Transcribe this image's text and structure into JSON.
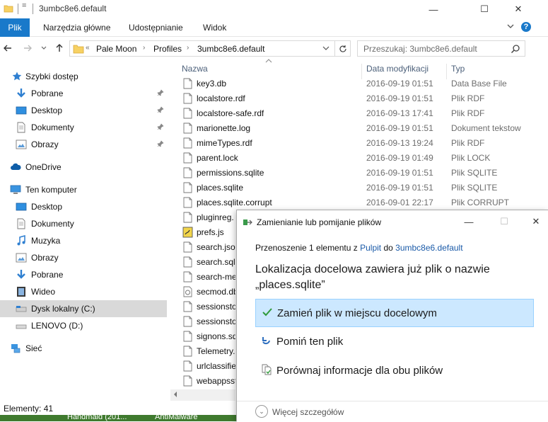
{
  "window": {
    "title": "3umbc8e6.default",
    "quick_access_dropdown": "=",
    "minimize": "—",
    "maximize": "☐",
    "close": "✕"
  },
  "ribbon": {
    "tabs": [
      "Plik",
      "Narzędzia główne",
      "Udostępnianie",
      "Widok"
    ],
    "help": "?"
  },
  "address": {
    "prefix": "«",
    "crumbs": [
      "Pale Moon",
      "Profiles",
      "3umbc8e6.default"
    ],
    "search_placeholder": "Przeszukaj: 3umbc8e6.default"
  },
  "navpane": {
    "items": [
      {
        "label": "Szybki dostęp",
        "icon": "star-icon",
        "pinned": false
      },
      {
        "label": "Pobrane",
        "icon": "download-arrow-icon",
        "pinned": true
      },
      {
        "label": "Desktop",
        "icon": "desktop-icon",
        "pinned": true
      },
      {
        "label": "Dokumenty",
        "icon": "documents-icon",
        "pinned": true
      },
      {
        "label": "Obrazy",
        "icon": "pictures-icon",
        "pinned": true
      },
      {
        "label": "OneDrive",
        "icon": "cloud-icon",
        "pinned": false
      },
      {
        "label": "Ten komputer",
        "icon": "computer-icon",
        "pinned": false
      },
      {
        "label": "Desktop",
        "icon": "desktop-icon",
        "pinned": false
      },
      {
        "label": "Dokumenty",
        "icon": "documents-icon",
        "pinned": false
      },
      {
        "label": "Muzyka",
        "icon": "music-icon",
        "pinned": false
      },
      {
        "label": "Obrazy",
        "icon": "pictures-icon",
        "pinned": false
      },
      {
        "label": "Pobrane",
        "icon": "download-arrow-icon",
        "pinned": false
      },
      {
        "label": "Wideo",
        "icon": "video-icon",
        "pinned": false
      },
      {
        "label": "Dysk lokalny (C:)",
        "icon": "drive-icon",
        "pinned": false,
        "selected": true
      },
      {
        "label": "LENOVO (D:)",
        "icon": "drive-icon",
        "pinned": false
      },
      {
        "label": "Sieć",
        "icon": "network-icon",
        "pinned": false
      }
    ]
  },
  "filelist": {
    "columns": {
      "name": "Nazwa",
      "date": "Data modyfikacji",
      "type": "Typ"
    },
    "rows": [
      {
        "name": "key3.db",
        "date": "2016-09-19 01:51",
        "type": "Data Base File"
      },
      {
        "name": "localstore.rdf",
        "date": "2016-09-19 01:51",
        "type": "Plik RDF"
      },
      {
        "name": "localstore-safe.rdf",
        "date": "2016-09-13 17:41",
        "type": "Plik RDF"
      },
      {
        "name": "marionette.log",
        "date": "2016-09-19 01:51",
        "type": "Dokument tekstow"
      },
      {
        "name": "mimeTypes.rdf",
        "date": "2016-09-13 19:24",
        "type": "Plik RDF"
      },
      {
        "name": "parent.lock",
        "date": "2016-09-19 01:49",
        "type": "Plik LOCK"
      },
      {
        "name": "permissions.sqlite",
        "date": "2016-09-19 01:51",
        "type": "Plik SQLITE"
      },
      {
        "name": "places.sqlite",
        "date": "2016-09-19 01:51",
        "type": "Plik SQLITE"
      },
      {
        "name": "places.sqlite.corrupt",
        "date": "2016-09-01 22:17",
        "type": "Plik CORRUPT"
      },
      {
        "name": "pluginreg.",
        "date": "",
        "type": ""
      },
      {
        "name": "prefs.js",
        "date": "",
        "type": ""
      },
      {
        "name": "search.json",
        "date": "",
        "type": ""
      },
      {
        "name": "search.sqli",
        "date": "",
        "type": ""
      },
      {
        "name": "search-me",
        "date": "",
        "type": ""
      },
      {
        "name": "secmod.db",
        "date": "",
        "type": ""
      },
      {
        "name": "sessionsto",
        "date": "",
        "type": ""
      },
      {
        "name": "sessionsto",
        "date": "",
        "type": ""
      },
      {
        "name": "signons.sq",
        "date": "",
        "type": ""
      },
      {
        "name": "Telemetry.",
        "date": "",
        "type": ""
      },
      {
        "name": "urlclassifie",
        "date": "",
        "type": ""
      },
      {
        "name": "webappsst",
        "date": "",
        "type": ""
      }
    ]
  },
  "status": {
    "count": "Elementy: 41"
  },
  "taskbar": {
    "items": [
      "Handmaid (201...",
      "AntiMalware"
    ]
  },
  "dialog": {
    "title": "Zamienianie lub pomijanie plików",
    "minimize": "—",
    "maximize": "☐",
    "close": "✕",
    "info_prefix": "Przenoszenie 1 elementu z ",
    "info_source": "Pulpit",
    "info_middle": " do ",
    "info_dest": "3umbc8e6.default",
    "heading": "Lokalizacja docelowa zawiera już plik o nazwie „places.sqlite”",
    "options": [
      {
        "label": "Zamień plik w miejscu docelowym",
        "icon": "checkmark-icon"
      },
      {
        "label": "Pomiń ten plik",
        "icon": "skip-arrow-icon"
      },
      {
        "label": "Porównaj informacje dla obu plików",
        "icon": "compare-files-icon"
      }
    ],
    "more_details": "Więcej szczegółów",
    "more_chevron": "⌄"
  },
  "colors": {
    "accent": "#1979ca",
    "selected_option_bg": "#cce8ff",
    "link": "#1a5aa8"
  }
}
